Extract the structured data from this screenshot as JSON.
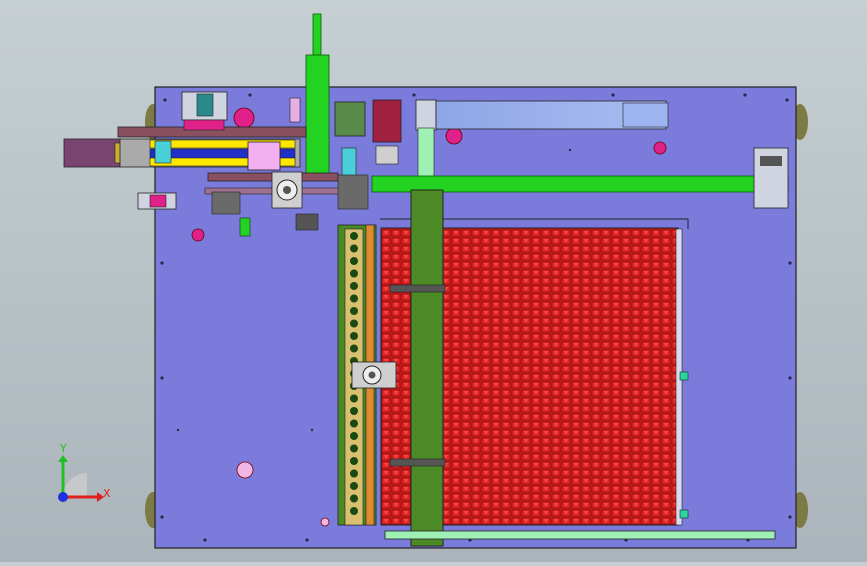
{
  "viewport": {
    "background_top": "#c6cfd3",
    "background_bottom": "#aab4ba"
  },
  "model": {
    "base_plate_color": "#7b7bdc",
    "feeder_rail_color": "#22d322",
    "gantry_beam_color": "#4c8a26",
    "tray_color": "#cc1f1f",
    "cylinder_color": "#ffe800",
    "accent_pink": "#e0218a",
    "motor_color": "#7a4470",
    "slide_blue": "#8fa6e6"
  },
  "axis_triad": {
    "x_label": "X",
    "y_label": "Y",
    "x_color": "#e02020",
    "y_color": "#20c020",
    "z_color": "#2030e0"
  },
  "icons": {
    "triad": "coordinate-axes-icon"
  }
}
